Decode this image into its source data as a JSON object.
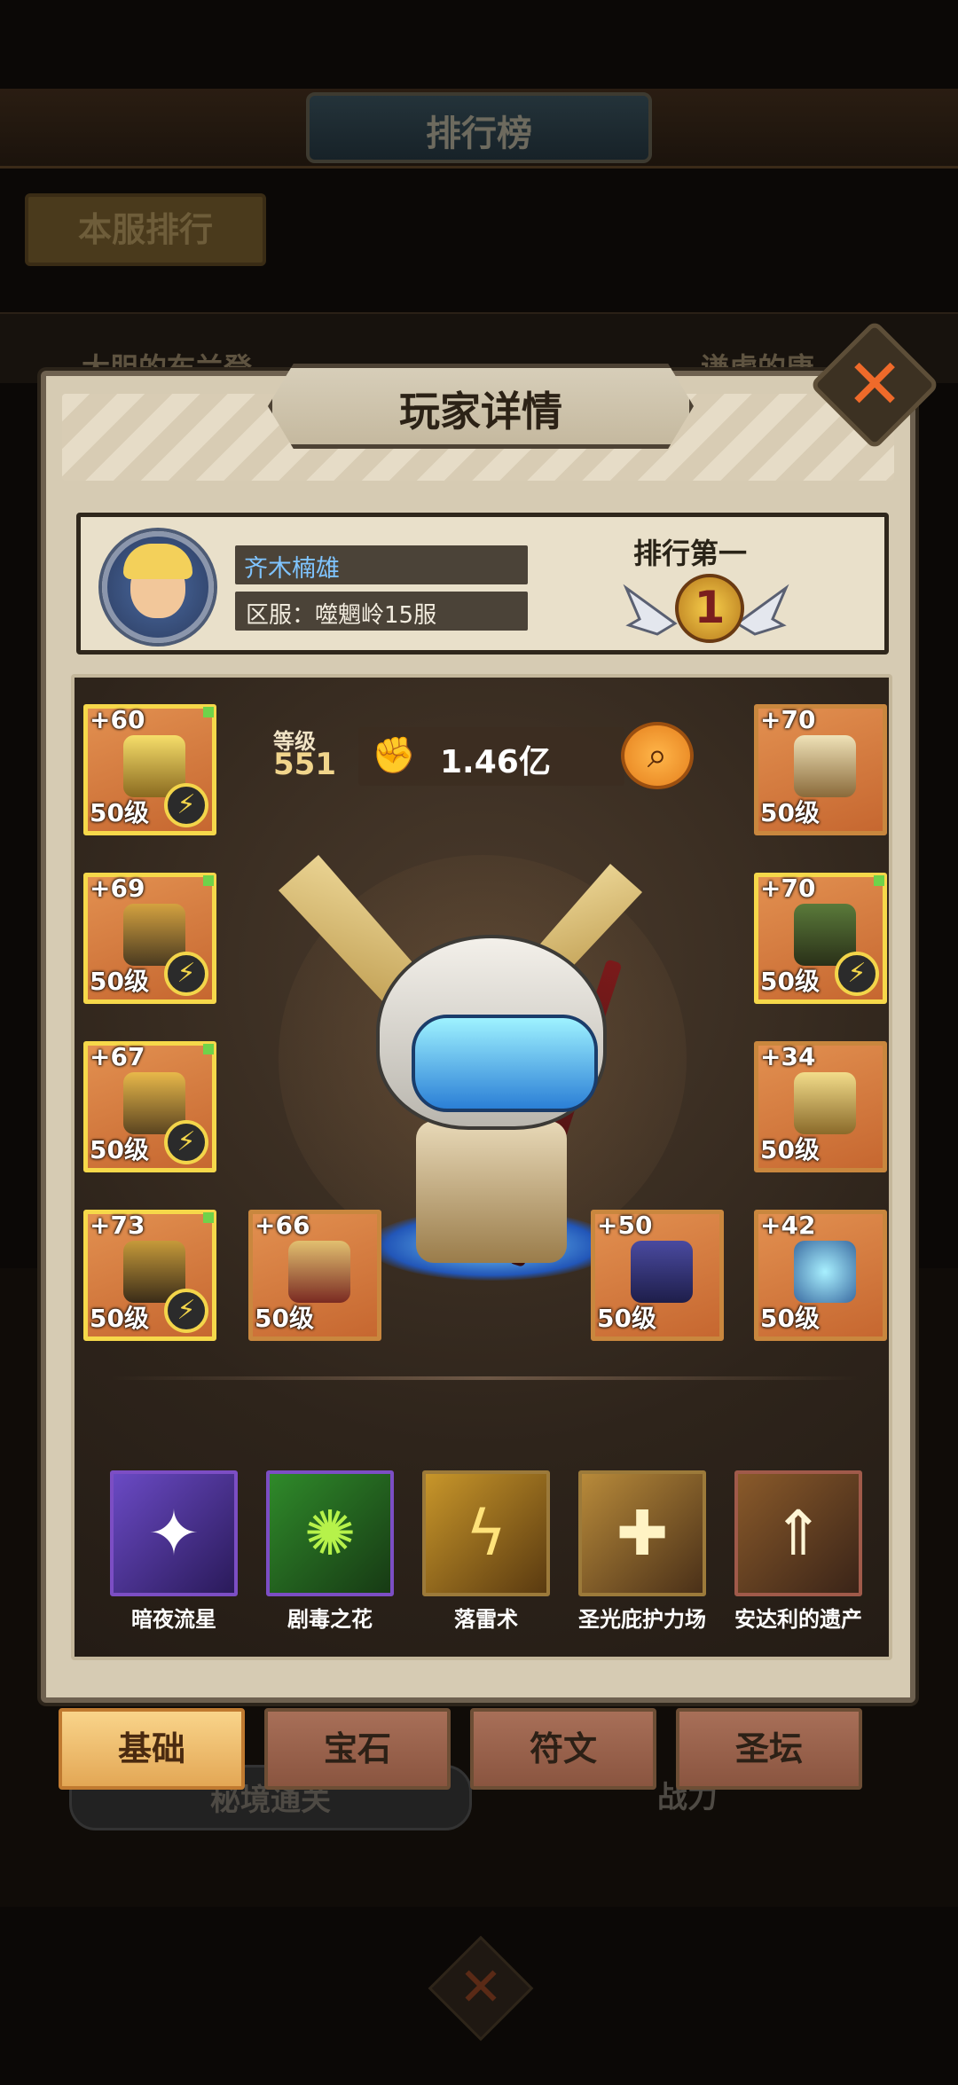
{
  "background": {
    "leaderboard_title": "排行榜",
    "server_rank_tab": "本服排行",
    "row_names": [
      "大胆的布兰登",
      "谦虚的唐"
    ],
    "sub_tabs": [
      "秘境通关",
      "战力"
    ]
  },
  "modal": {
    "title": "玩家详情",
    "close_icon": "close-x-icon"
  },
  "player": {
    "name": "齐木楠雄",
    "server": "区服：噬魍岭15服",
    "rank_label": "排行第一",
    "rank_number": "1"
  },
  "stats": {
    "level_label": "等级",
    "level_value": "551",
    "power_value": "1.46亿"
  },
  "equipment": {
    "left": [
      {
        "plus": "+60",
        "level": "50级",
        "awakened": true
      },
      {
        "plus": "+69",
        "level": "50级",
        "awakened": true
      },
      {
        "plus": "+67",
        "level": "50级",
        "awakened": true
      },
      {
        "plus": "+73",
        "level": "50级",
        "awakened": true
      }
    ],
    "right": [
      {
        "plus": "+70",
        "level": "50级",
        "awakened": false
      },
      {
        "plus": "+70",
        "level": "50级",
        "awakened": true
      },
      {
        "plus": "+34",
        "level": "50级",
        "awakened": false
      },
      {
        "plus": "+42",
        "level": "50级",
        "awakened": false
      }
    ],
    "bottom_middle": [
      {
        "plus": "+66",
        "level": "50级"
      },
      {
        "plus": "+50",
        "level": "50级"
      }
    ],
    "bolt_glyph": "⚡"
  },
  "skills": [
    {
      "name": "暗夜流星",
      "icon": "meteor-icon",
      "glyph": "✦",
      "color": "#5a3a9e"
    },
    {
      "name": "剧毒之花",
      "icon": "poison-flower-icon",
      "glyph": "✺",
      "color": "#2f6a2a"
    },
    {
      "name": "落雷术",
      "icon": "lightning-icon",
      "glyph": "ϟ",
      "color": "#8a6a20"
    },
    {
      "name": "圣光庇护力场",
      "icon": "holy-shield-icon",
      "glyph": "✚",
      "color": "#7a5a2a"
    },
    {
      "name": "安达利的遗产",
      "icon": "ascend-arrow-icon",
      "glyph": "⇑",
      "color": "#6a4a22"
    }
  ],
  "tabs": [
    {
      "label": "基础",
      "active": true
    },
    {
      "label": "宝石",
      "active": false
    },
    {
      "label": "符文",
      "active": false
    },
    {
      "label": "圣坛",
      "active": false
    }
  ],
  "colors": {
    "accent_orange": "#ef6a2a",
    "gold": "#f6d84a",
    "name_blue": "#7fc4ff"
  }
}
